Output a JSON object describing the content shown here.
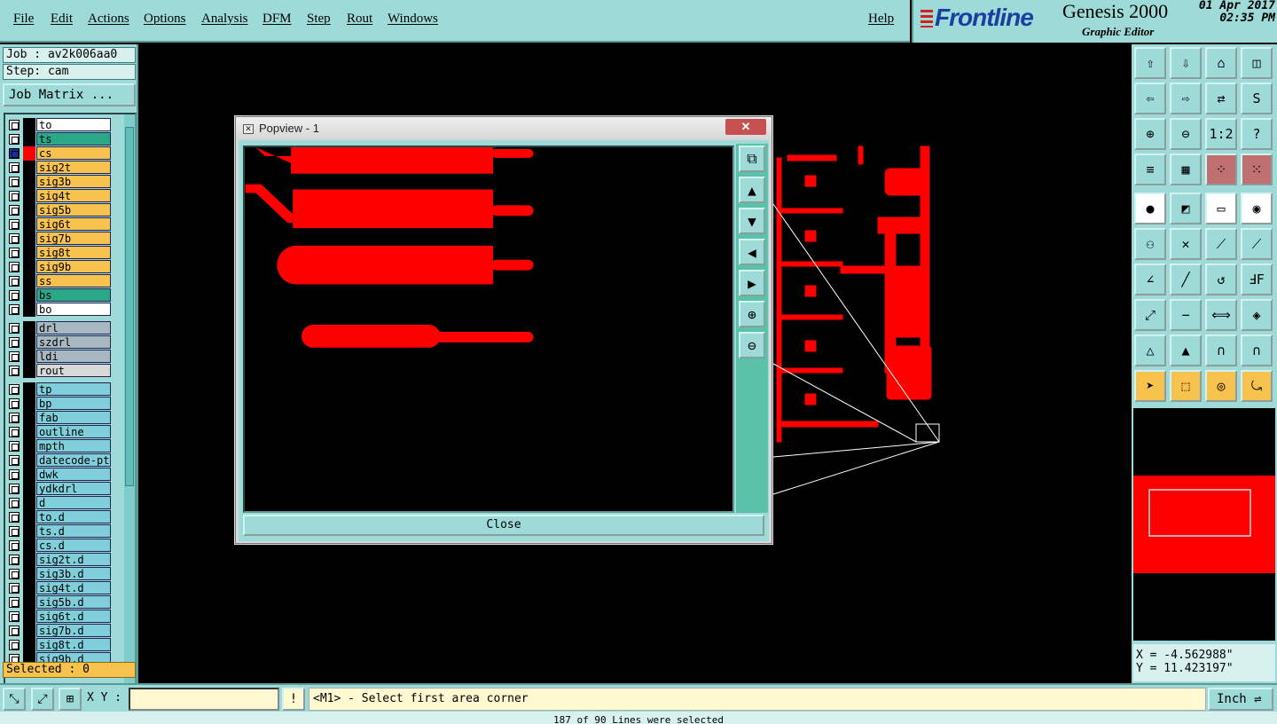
{
  "menu": [
    "File",
    "Edit",
    "Actions",
    "Options",
    "Analysis",
    "DFM",
    "Step",
    "Rout",
    "Windows"
  ],
  "help_label": "Help",
  "brand": {
    "logo": "Frontline",
    "product": "Genesis 2000",
    "subtitle": "Graphic Editor",
    "date": "01 Apr 2017",
    "time": "02:35 PM"
  },
  "job": {
    "job_line": "Job : av2k006aa0",
    "step_line": "Step: cam",
    "matrix_button": "Job Matrix ..."
  },
  "layers": [
    {
      "name": "to",
      "bg": "#ffffff"
    },
    {
      "name": "ts",
      "bg": "#2aa887"
    },
    {
      "name": "cs",
      "bg": "#f7c24e",
      "active": true
    },
    {
      "name": "sig2t",
      "bg": "#f7c24e"
    },
    {
      "name": "sig3b",
      "bg": "#f7c24e"
    },
    {
      "name": "sig4t",
      "bg": "#f7c24e"
    },
    {
      "name": "sig5b",
      "bg": "#f7c24e"
    },
    {
      "name": "sig6t",
      "bg": "#f7c24e"
    },
    {
      "name": "sig7b",
      "bg": "#f7c24e"
    },
    {
      "name": "sig8t",
      "bg": "#f7c24e"
    },
    {
      "name": "sig9b",
      "bg": "#f7c24e"
    },
    {
      "name": "ss",
      "bg": "#f7c24e"
    },
    {
      "name": "bs",
      "bg": "#2aa887"
    },
    {
      "name": "bo",
      "bg": "#ffffff"
    },
    {
      "name": "drl",
      "bg": "#a8b8c0",
      "gap": 5
    },
    {
      "name": "szdrl",
      "bg": "#a8b8c0"
    },
    {
      "name": "ldi",
      "bg": "#a8b8c0"
    },
    {
      "name": "rout",
      "bg": "#d8d8d8"
    },
    {
      "name": "tp",
      "bg": "#7fcfda",
      "gap": 5
    },
    {
      "name": "bp",
      "bg": "#7fcfda"
    },
    {
      "name": "fab",
      "bg": "#7fcfda"
    },
    {
      "name": "outline",
      "bg": "#7fcfda"
    },
    {
      "name": "mpth",
      "bg": "#7fcfda"
    },
    {
      "name": "datecode-ptc",
      "bg": "#7fcfda"
    },
    {
      "name": "dwk",
      "bg": "#7fcfda"
    },
    {
      "name": "ydkdrl",
      "bg": "#7fcfda"
    },
    {
      "name": "d",
      "bg": "#7fcfda"
    },
    {
      "name": "to.d",
      "bg": "#7fcfda"
    },
    {
      "name": "ts.d",
      "bg": "#7fcfda"
    },
    {
      "name": "cs.d",
      "bg": "#7fcfda"
    },
    {
      "name": "sig2t.d",
      "bg": "#7fcfda"
    },
    {
      "name": "sig3b.d",
      "bg": "#7fcfda"
    },
    {
      "name": "sig4t.d",
      "bg": "#7fcfda"
    },
    {
      "name": "sig5b.d",
      "bg": "#7fcfda"
    },
    {
      "name": "sig6t.d",
      "bg": "#7fcfda"
    },
    {
      "name": "sig7b.d",
      "bg": "#7fcfda"
    },
    {
      "name": "sig8t.d",
      "bg": "#7fcfda"
    },
    {
      "name": "sig9b.d",
      "bg": "#7fcfda"
    }
  ],
  "selected": "Selected : 0",
  "popup": {
    "title": "Popview - 1",
    "close_x": "✕",
    "close_button": "Close"
  },
  "coords": {
    "x": "X = -4.562988\"",
    "y": "Y = 11.423197\""
  },
  "bottom": {
    "xy_label": "X Y :",
    "prompt": "<M1> - Select first area corner",
    "unit": "Inch ⇌"
  },
  "status": "187 of 90 Lines were selected",
  "colors": {
    "panel": "#9ddad8",
    "copper": "#ff0000",
    "highlight": "#f7c24e"
  }
}
